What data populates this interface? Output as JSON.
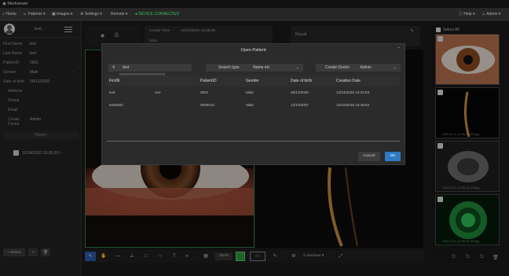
{
  "app": {
    "title": "Medviewer"
  },
  "menu": {
    "items": [
      {
        "label": "Home"
      },
      {
        "label": "Patients ▾"
      },
      {
        "label": "Images ▾"
      },
      {
        "label": "Settings ▾"
      },
      {
        "label": "Remote ▾"
      },
      {
        "label": "DEVICE CONNECTED"
      }
    ],
    "help": "Help ▾",
    "user": "Admin ▾"
  },
  "sidebar": {
    "name": "test",
    "fields": [
      {
        "label": "First Name",
        "value": "test"
      },
      {
        "label": "Last Name",
        "value": "test"
      },
      {
        "label": "PatientID",
        "value": "0001"
      },
      {
        "label": "Gender",
        "value": "Male"
      },
      {
        "label": "Date of birth",
        "value": "09/12/2020"
      },
      {
        "label": "Address",
        "value": ""
      },
      {
        "label": "Phone",
        "value": ""
      },
      {
        "label": "Email",
        "value": ""
      },
      {
        "label": "Create Doctor",
        "value": "Admin"
      }
    ],
    "history_label": "History",
    "history_item": "10/24/2020 16:35:00",
    "history_button": "+ Widow"
  },
  "exam": {
    "create_time_label": "Create Time",
    "create_time_value": "12/24/2020 16:35:36",
    "note_label": "Note",
    "result_label": "Result"
  },
  "thumbs": {
    "select_all": "Select All",
    "captions": [
      "2020-12-24_16-35-36_001.jpg",
      "2020-12-24_16-35-40_002.jpg",
      "2020-12-24_16-35-44_003.jpg",
      "2020-12-24_16-35-48_004.jpg"
    ]
  },
  "toolbar": {
    "zoom": "100%",
    "views": "2 windows ▾"
  },
  "dialog": {
    "title": "Open Patient",
    "search_value": "test",
    "dropdown_option": "test",
    "search_type_label": "Search type",
    "search_type_value": "Name etc",
    "create_doctor_label": "Create Doctor",
    "create_doctor_value": "Admin",
    "columns": [
      "FirstN",
      "",
      "PatientID",
      "Gender",
      "Date of birth",
      "Creation Date"
    ],
    "rows": [
      [
        "test",
        "one",
        "0001",
        "Male",
        "09/12/2020",
        "12/24/2020 16:32:53"
      ],
      [
        "test0000",
        "",
        "0000010",
        "Male",
        "12/10/2007",
        "12/10/2018 16:48:52"
      ]
    ],
    "cancel": "Cancel",
    "ok": "OK"
  }
}
